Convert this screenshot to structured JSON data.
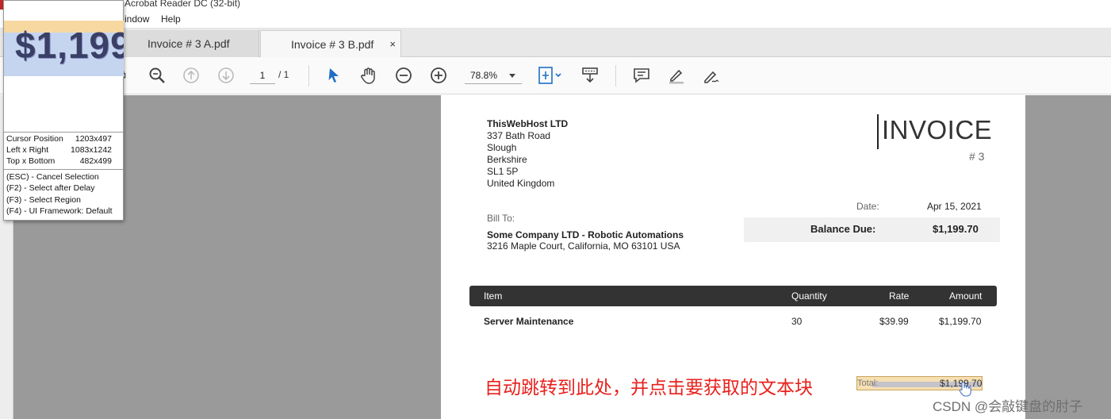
{
  "window": {
    "title": "Acrobat Reader DC (32-bit)"
  },
  "menu": {
    "items": [
      "indow",
      "Help"
    ]
  },
  "tabs": [
    {
      "label": "Invoice # 3 A.pdf",
      "active": false
    },
    {
      "label": "Invoice # 3 B.pdf",
      "active": true,
      "close": "×"
    }
  ],
  "toolbar": {
    "page_current": "1",
    "page_total": "/ 1",
    "zoom": "78.8%"
  },
  "invoice": {
    "company": "ThisWebHost LTD",
    "address_lines": [
      "337 Bath Road",
      "Slough",
      "Berkshire",
      "SL1 5P",
      "United Kingdom"
    ],
    "title": "INVOICE",
    "number": "# 3",
    "date_label": "Date:",
    "date_value": "Apr 15, 2021",
    "balance_label": "Balance Due:",
    "balance_value": "$1,199.70",
    "bill_to_label": "Bill To:",
    "bill_to_name": "Some Company LTD - Robotic Automations",
    "bill_to_address": "3216 Maple Court, California, MO 63101 USA",
    "table": {
      "headers": [
        "Item",
        "Quantity",
        "Rate",
        "Amount"
      ],
      "rows": [
        {
          "item": "Server Maintenance",
          "quantity": "30",
          "rate": "$39.99",
          "amount": "$1,199.70"
        }
      ]
    },
    "total_label": "Total:",
    "total_value": "$1,199.70"
  },
  "annotation": "自动跳转到此处，并点击要获取的文本块",
  "watermark": "CSDN @会敲键盘的肘子",
  "inspector": {
    "magnified_text": "$1,199",
    "rows": [
      {
        "label": "Cursor Position",
        "value": "1203x497"
      },
      {
        "label": "Left x Right",
        "value": "1083x1242"
      },
      {
        "label": "Top x Bottom",
        "value": "482x499"
      }
    ],
    "shortcuts": [
      "(ESC) - Cancel Selection",
      "(F2)    - Select after Delay",
      "(F3)    - Select Region",
      "(F4)    - UI Framework: Default"
    ]
  },
  "colors": {
    "annotation_red": "#e8211d",
    "table_header": "#333333",
    "doc_background": "#9a9a9a",
    "selection_highlight": "#f6e0b3",
    "toolbar_blue": "#1f6fc5"
  }
}
